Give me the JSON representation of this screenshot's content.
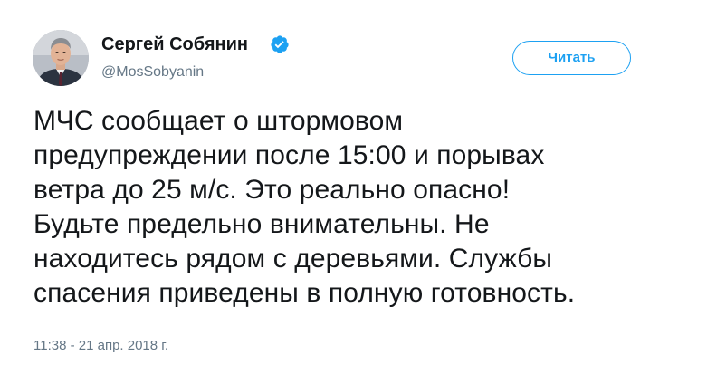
{
  "user": {
    "display_name": "Сергей Собянин",
    "handle": "@MosSobyanin",
    "verified": true,
    "avatar": "portrait-photo",
    "verified_icon": "verified-badge-icon"
  },
  "follow_button": {
    "label": "Читать"
  },
  "tweet": {
    "lines": [
      "МЧС сообщает о штормовом",
      "предупреждении после 15:00 и порывах",
      "ветра до 25 м/с. Это реально опасно!",
      "Будьте предельно внимательны. Не",
      "находитесь рядом с деревьями. Службы",
      "спасения приведены в полную готовность."
    ],
    "timestamp": "11:38 - 21 апр. 2018 г."
  },
  "colors": {
    "accent": "#1da1f2",
    "text": "#14171a",
    "secondary_text": "#657786",
    "background": "#ffffff"
  }
}
